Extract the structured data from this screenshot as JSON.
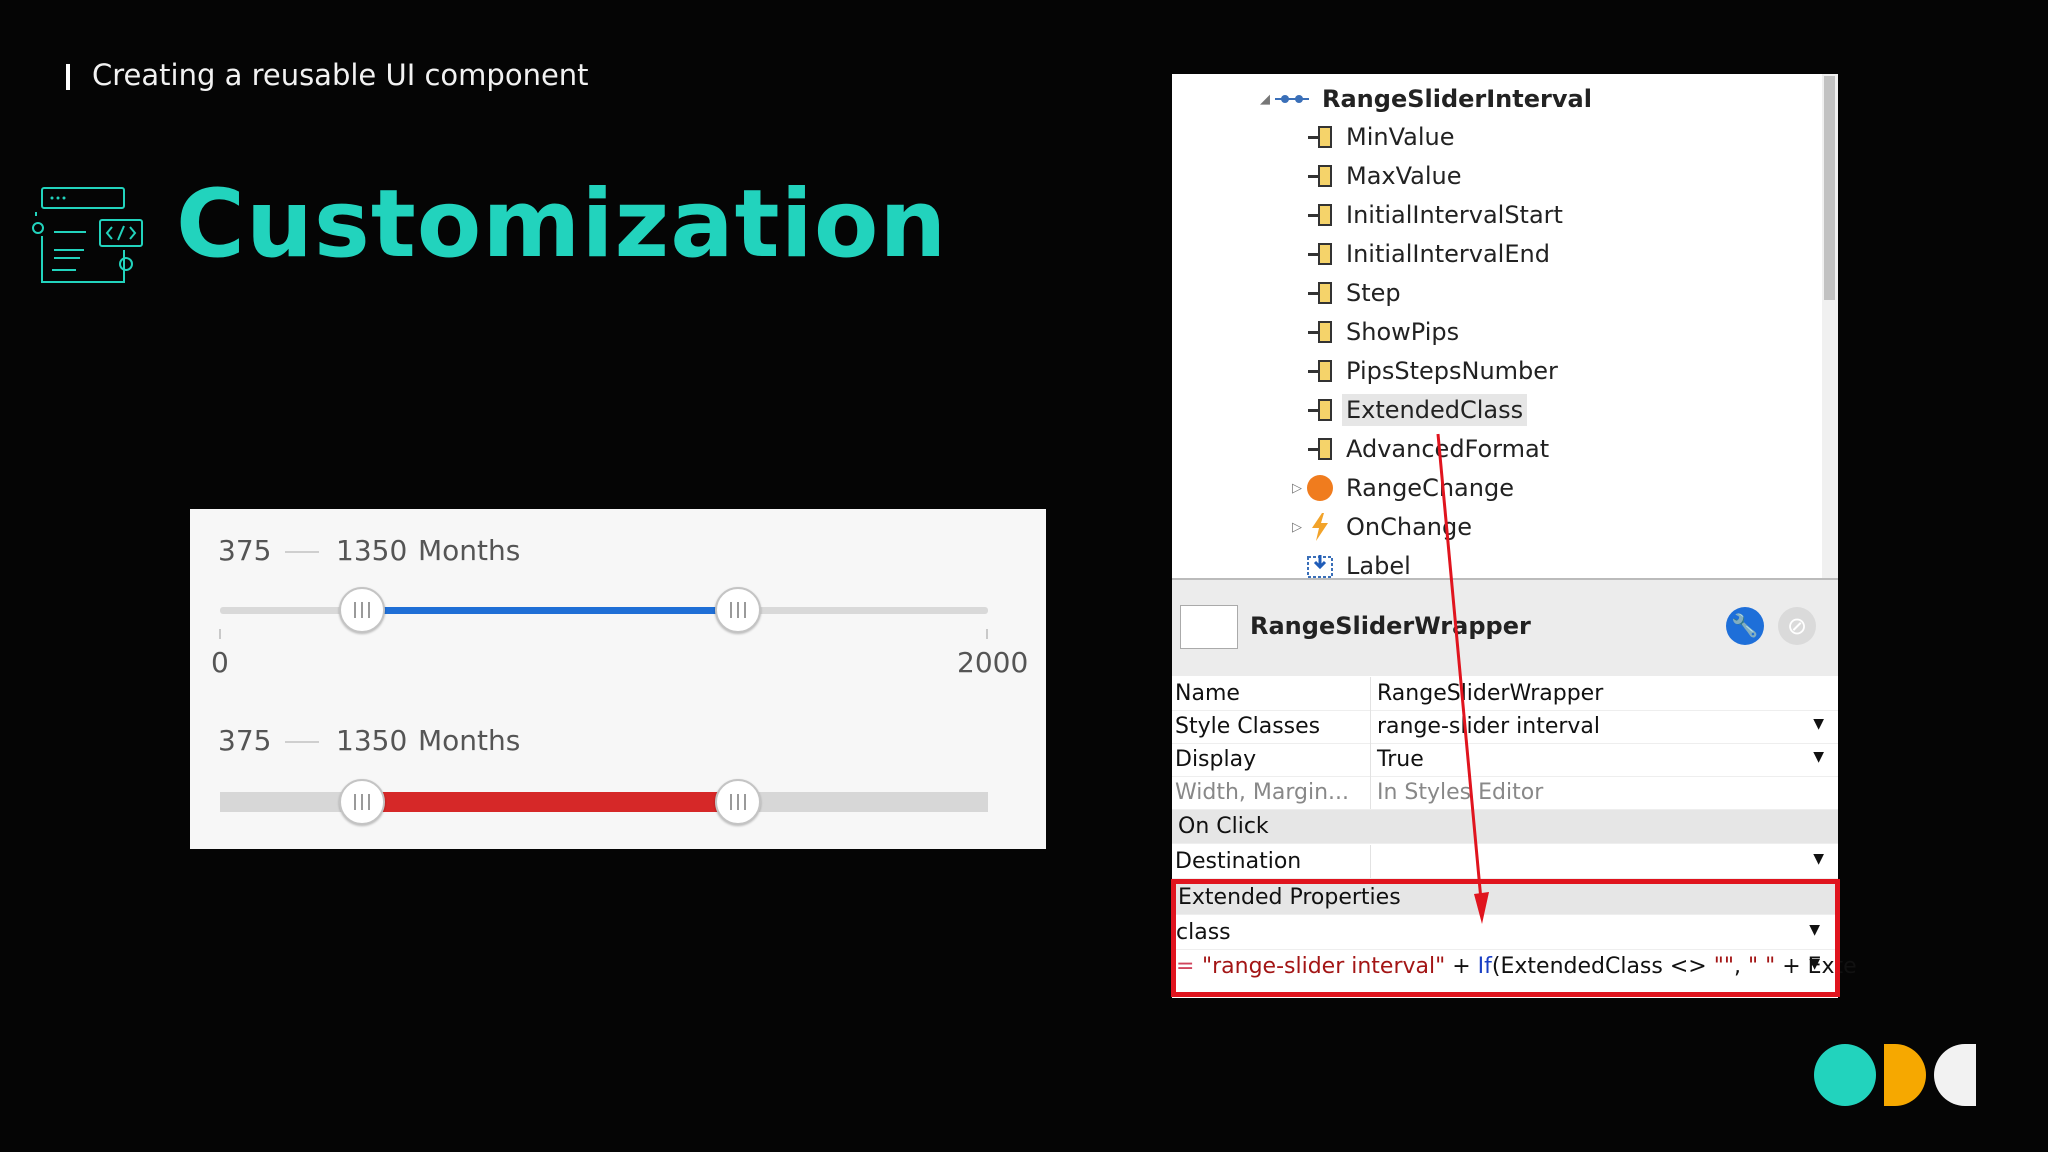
{
  "header": {
    "subtitle": "Creating a reusable UI component",
    "title": "Customization"
  },
  "slider_demo": {
    "blue_slider": {
      "start": "375",
      "end": "1350",
      "unit": "Months",
      "min_label": "0",
      "max_label": "2000",
      "accent": "#1f6fd6"
    },
    "red_slider": {
      "start": "375",
      "end": "1350",
      "unit": "Months",
      "accent": "#d62828"
    }
  },
  "tree": {
    "root": "RangeSliderInterval",
    "items": [
      {
        "label": "MinValue",
        "icon": "input-parameter-icon"
      },
      {
        "label": "MaxValue",
        "icon": "input-parameter-icon"
      },
      {
        "label": "InitialIntervalStart",
        "icon": "input-parameter-icon"
      },
      {
        "label": "InitialIntervalEnd",
        "icon": "input-parameter-icon"
      },
      {
        "label": "Step",
        "icon": "input-parameter-icon"
      },
      {
        "label": "ShowPips",
        "icon": "input-parameter-icon"
      },
      {
        "label": "PipsStepsNumber",
        "icon": "input-parameter-icon"
      },
      {
        "label": "ExtendedClass",
        "icon": "input-parameter-icon"
      },
      {
        "label": "AdvancedFormat",
        "icon": "input-parameter-icon"
      },
      {
        "label": "RangeChange",
        "icon": "event-icon"
      },
      {
        "label": "OnChange",
        "icon": "action-icon"
      },
      {
        "label": "Label",
        "icon": "placeholder-icon"
      }
    ]
  },
  "properties": {
    "title": "RangeSliderWrapper",
    "rows": {
      "name": {
        "key": "Name",
        "value": "RangeSliderWrapper"
      },
      "style_classes": {
        "key": "Style Classes",
        "value": "range-slider interval"
      },
      "display": {
        "key": "Display",
        "value": "True"
      },
      "width": {
        "key": "Width, Margin...",
        "value": "In Styles Editor"
      },
      "on_click": "On Click",
      "destination": {
        "key": "Destination",
        "value": ""
      },
      "extended": "Extended Properties",
      "class_key": "class",
      "expr_prefix": "=",
      "expr_str1": "\"range-slider interval\"",
      "expr_plus1": " + ",
      "expr_if": "If",
      "expr_mid": "(ExtendedClass <> ",
      "expr_str2": "\"\"",
      "expr_comma": ", ",
      "expr_str3": "\" \"",
      "expr_tail": " + Exte"
    }
  },
  "colors": {
    "title": "#22d3bd",
    "highlight_box": "#e0141e",
    "logo": [
      "#22d3bd",
      "#f6a800",
      "#f2f2f2"
    ]
  }
}
